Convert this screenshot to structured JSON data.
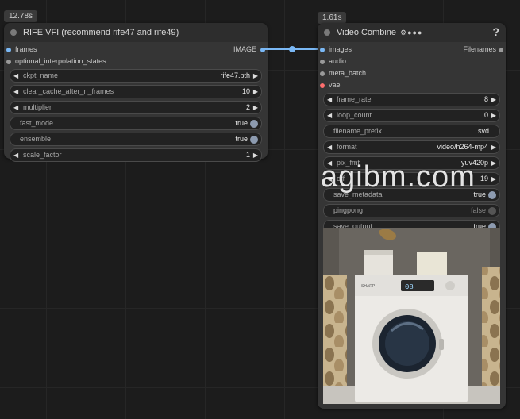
{
  "node_rife": {
    "time": "12.78s",
    "title": "RIFE VFI (recommend rife47 and rife49)",
    "inputs": [
      {
        "label": "frames",
        "connected": true,
        "color": "#7ab8f5"
      },
      {
        "label": "optional_interpolation_states",
        "connected": false,
        "color": "#9a9a9a"
      }
    ],
    "output": {
      "label": "IMAGE",
      "color": "#7ab8f5"
    },
    "widgets": [
      {
        "name": "ckpt_name",
        "value": "rife47.pth"
      },
      {
        "name": "clear_cache_after_n_frames",
        "value": "10"
      },
      {
        "name": "multiplier",
        "value": "2"
      },
      {
        "name": "fast_mode",
        "value": "true"
      },
      {
        "name": "ensemble",
        "value": "true"
      },
      {
        "name": "scale_factor",
        "value": "1"
      }
    ]
  },
  "node_video": {
    "time": "1.61s",
    "title": "Video Combine",
    "help": "?",
    "badge_icons": "⚙●●●",
    "inputs": [
      {
        "label": "images",
        "color": "#7ab8f5"
      },
      {
        "label": "audio",
        "color": "#9a9a9a"
      },
      {
        "label": "meta_batch",
        "color": "#9a9a9a"
      },
      {
        "label": "vae",
        "color": "#ff6e6e"
      }
    ],
    "output": {
      "label": "Filenames",
      "color": "#9a9a9a"
    },
    "widgets": [
      {
        "name": "frame_rate",
        "value": "8"
      },
      {
        "name": "loop_count",
        "value": "0"
      },
      {
        "name": "filename_prefix",
        "value": "svd"
      },
      {
        "name": "format",
        "value": "video/h264-mp4"
      },
      {
        "name": "pix_fmt",
        "value": "yuv420p"
      },
      {
        "name": "crf",
        "value": "19"
      },
      {
        "name": "save_metadata",
        "value": "true"
      },
      {
        "name": "pingpong",
        "value": "false"
      },
      {
        "name": "save_output",
        "value": "true"
      }
    ]
  },
  "preview": {
    "washer_brand": "SHARP",
    "washer_panel_text": "08"
  },
  "watermark": "agibm.com",
  "colors": {
    "background": "#1c1c1c",
    "node_body": "#353535",
    "node_header": "#2d2d2d",
    "link_image": "#7ab8f5",
    "slot_vae": "#ff6e6e"
  }
}
